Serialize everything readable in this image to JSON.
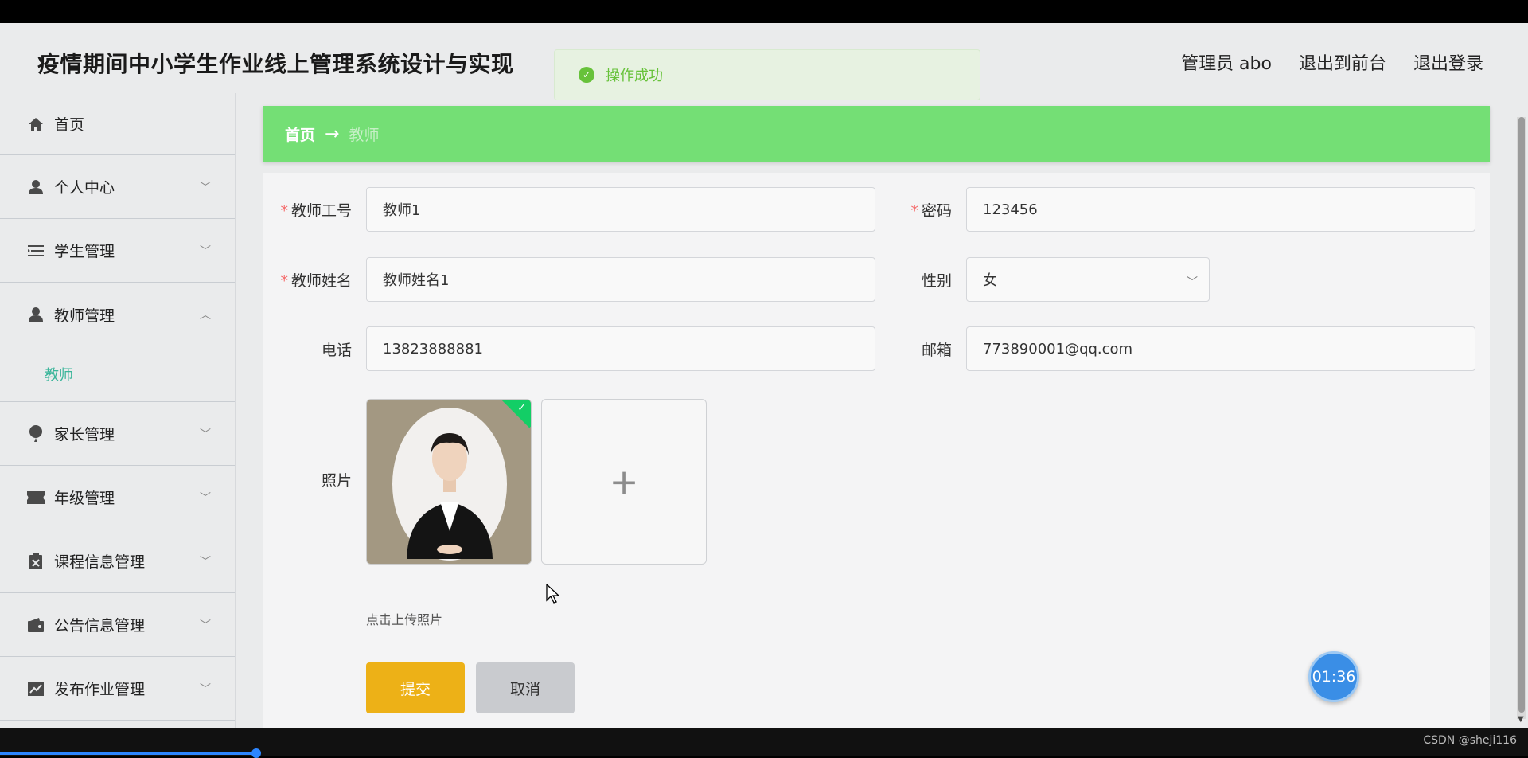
{
  "header": {
    "title": "疫情期间中小学生作业线上管理系统设计与实现",
    "toast": "操作成功",
    "user": "管理员 abo",
    "to_front": "退出到前台",
    "logout": "退出登录"
  },
  "sidebar": {
    "items": [
      {
        "label": "首页",
        "icon": "home-icon"
      },
      {
        "label": "个人中心",
        "icon": "user-icon"
      },
      {
        "label": "学生管理",
        "icon": "list-icon"
      },
      {
        "label": "教师管理",
        "icon": "user-icon"
      },
      {
        "label": "家长管理",
        "icon": "balloon-icon"
      },
      {
        "label": "年级管理",
        "icon": "ticket-icon"
      },
      {
        "label": "课程信息管理",
        "icon": "clipboard-icon"
      },
      {
        "label": "公告信息管理",
        "icon": "wallet-icon"
      },
      {
        "label": "发布作业管理",
        "icon": "chart-icon"
      }
    ],
    "sub_active": "教师"
  },
  "breadcrumb": {
    "home": "首页",
    "arrow": "→",
    "current": "教师"
  },
  "form": {
    "teacher_no_label": "教师工号",
    "teacher_no": "教师1",
    "password_label": "密码",
    "password": "123456",
    "teacher_name_label": "教师姓名",
    "teacher_name": "教师姓名1",
    "gender_label": "性别",
    "gender": "女",
    "phone_label": "电话",
    "phone": "13823888881",
    "email_label": "邮箱",
    "email": "773890001@qq.com",
    "photo_label": "照片",
    "upload_hint": "点击上传照片",
    "submit": "提交",
    "cancel": "取消"
  },
  "timer": "01:36",
  "watermark": "CSDN @sheji116",
  "colors": {
    "breadcrumb_bg": "#74df75",
    "submit_bg": "#edb117",
    "active_sub": "#3ab59a",
    "success": "#67c23a"
  }
}
